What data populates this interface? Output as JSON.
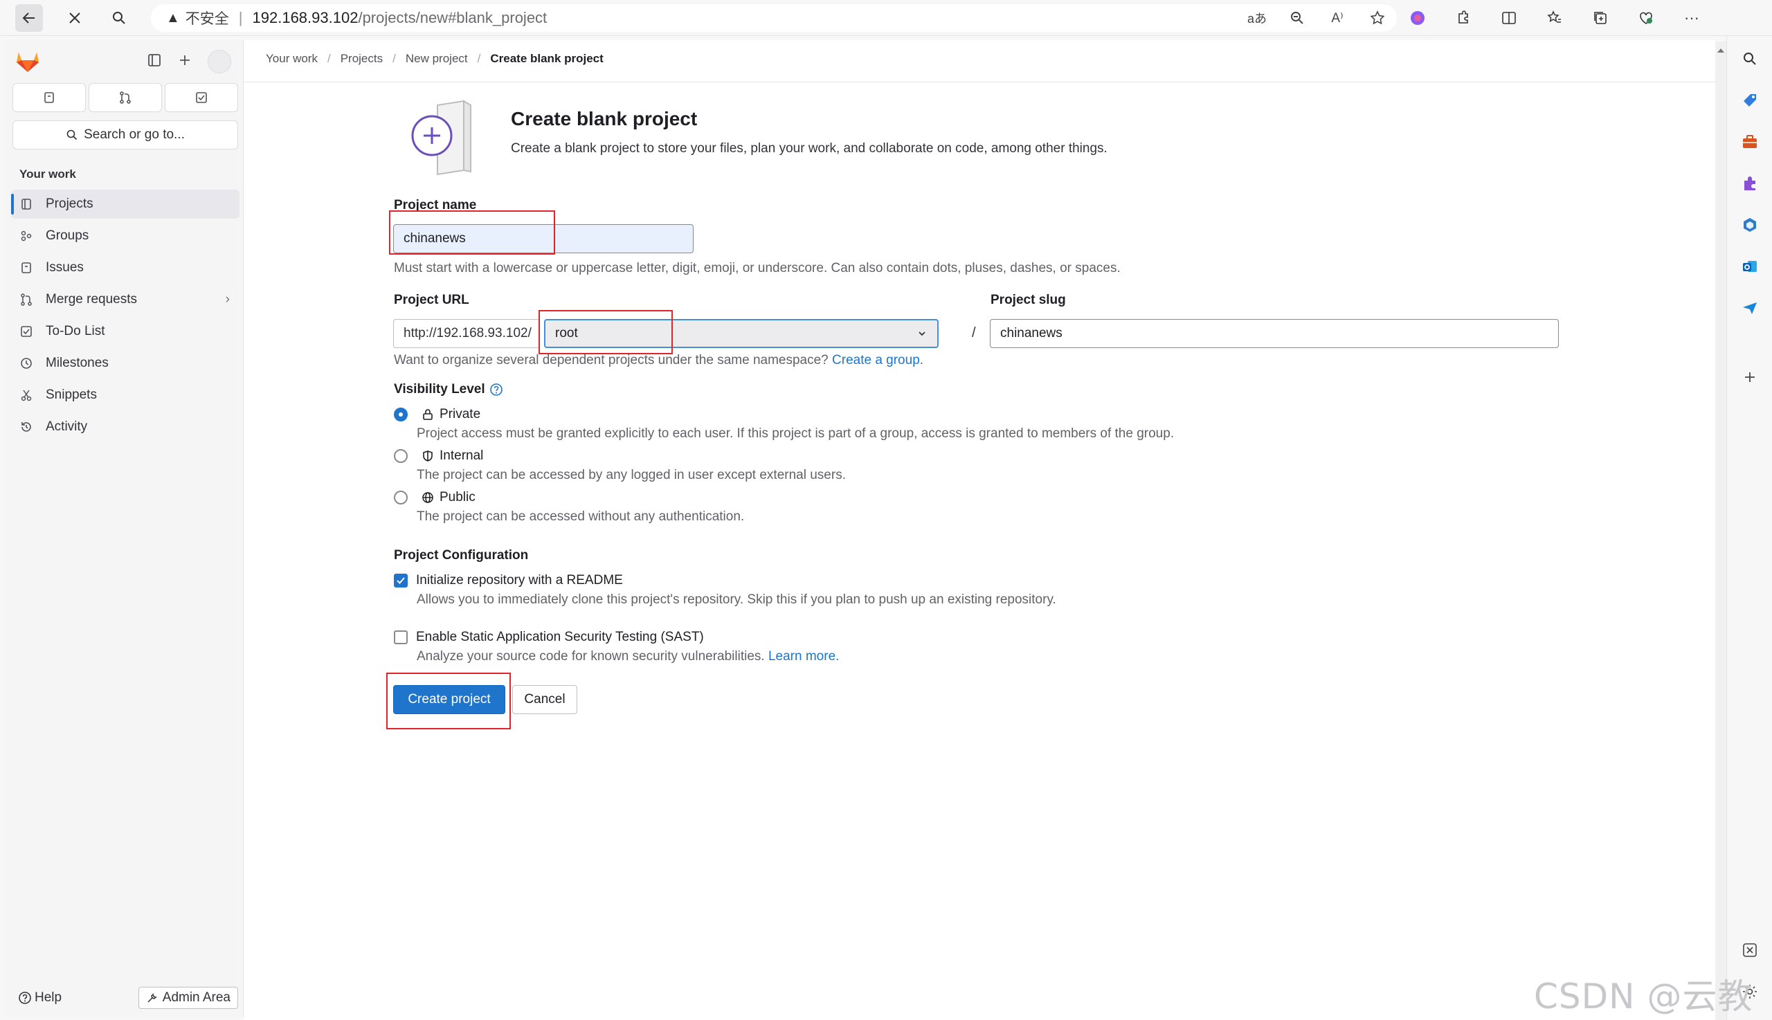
{
  "browser": {
    "insecure_label": "不安全",
    "url_host": "192.168.93.102",
    "url_path": "/projects/new#blank_project"
  },
  "sidebar": {
    "search_placeholder": "Search or go to...",
    "section_title": "Your work",
    "items": [
      {
        "label": "Projects",
        "icon": "project-icon"
      },
      {
        "label": "Groups",
        "icon": "group-icon"
      },
      {
        "label": "Issues",
        "icon": "issues-icon"
      },
      {
        "label": "Merge requests",
        "icon": "merge-request-icon"
      },
      {
        "label": "To-Do List",
        "icon": "todo-icon"
      },
      {
        "label": "Milestones",
        "icon": "milestone-icon"
      },
      {
        "label": "Snippets",
        "icon": "snippet-icon"
      },
      {
        "label": "Activity",
        "icon": "history-icon"
      }
    ],
    "help_label": "Help",
    "admin_label": "Admin Area"
  },
  "breadcrumb": [
    "Your work",
    "Projects",
    "New project",
    "Create blank project"
  ],
  "page": {
    "title": "Create blank project",
    "description": "Create a blank project to store your files, plan your work, and collaborate on code, among other things."
  },
  "form": {
    "project_name_label": "Project name",
    "project_name_value": "chinanews",
    "project_name_help": "Must start with a lowercase or uppercase letter, digit, emoji, or underscore. Can also contain dots, pluses, dashes, or spaces.",
    "project_url_label": "Project URL",
    "url_prefix": "http://192.168.93.102/",
    "namespace_value": "root",
    "slug_sep": "/",
    "project_slug_label": "Project slug",
    "project_slug_value": "chinanews",
    "namespace_help": "Want to organize several dependent projects under the same namespace?",
    "create_group_link": "Create a group.",
    "visibility_label": "Visibility Level",
    "visibility": [
      {
        "label": "Private",
        "desc": "Project access must be granted explicitly to each user. If this project is part of a group, access is granted to members of the group.",
        "selected": true
      },
      {
        "label": "Internal",
        "desc": "The project can be accessed by any logged in user except external users.",
        "selected": false
      },
      {
        "label": "Public",
        "desc": "The project can be accessed without any authentication.",
        "selected": false
      }
    ],
    "config_label": "Project Configuration",
    "readme_label": "Initialize repository with a README",
    "readme_desc": "Allows you to immediately clone this project's repository. Skip this if you plan to push up an existing repository.",
    "readme_checked": true,
    "sast_label": "Enable Static Application Security Testing (SAST)",
    "sast_desc": "Analyze your source code for known security vulnerabilities.",
    "sast_link": "Learn more.",
    "sast_checked": false,
    "create_button": "Create project",
    "cancel_button": "Cancel"
  },
  "watermark": "CSDN @云教员",
  "colors": {
    "primary": "#1f75cb",
    "highlight_box": "#e0242a",
    "gitlab_orange": "#fc6d26"
  }
}
